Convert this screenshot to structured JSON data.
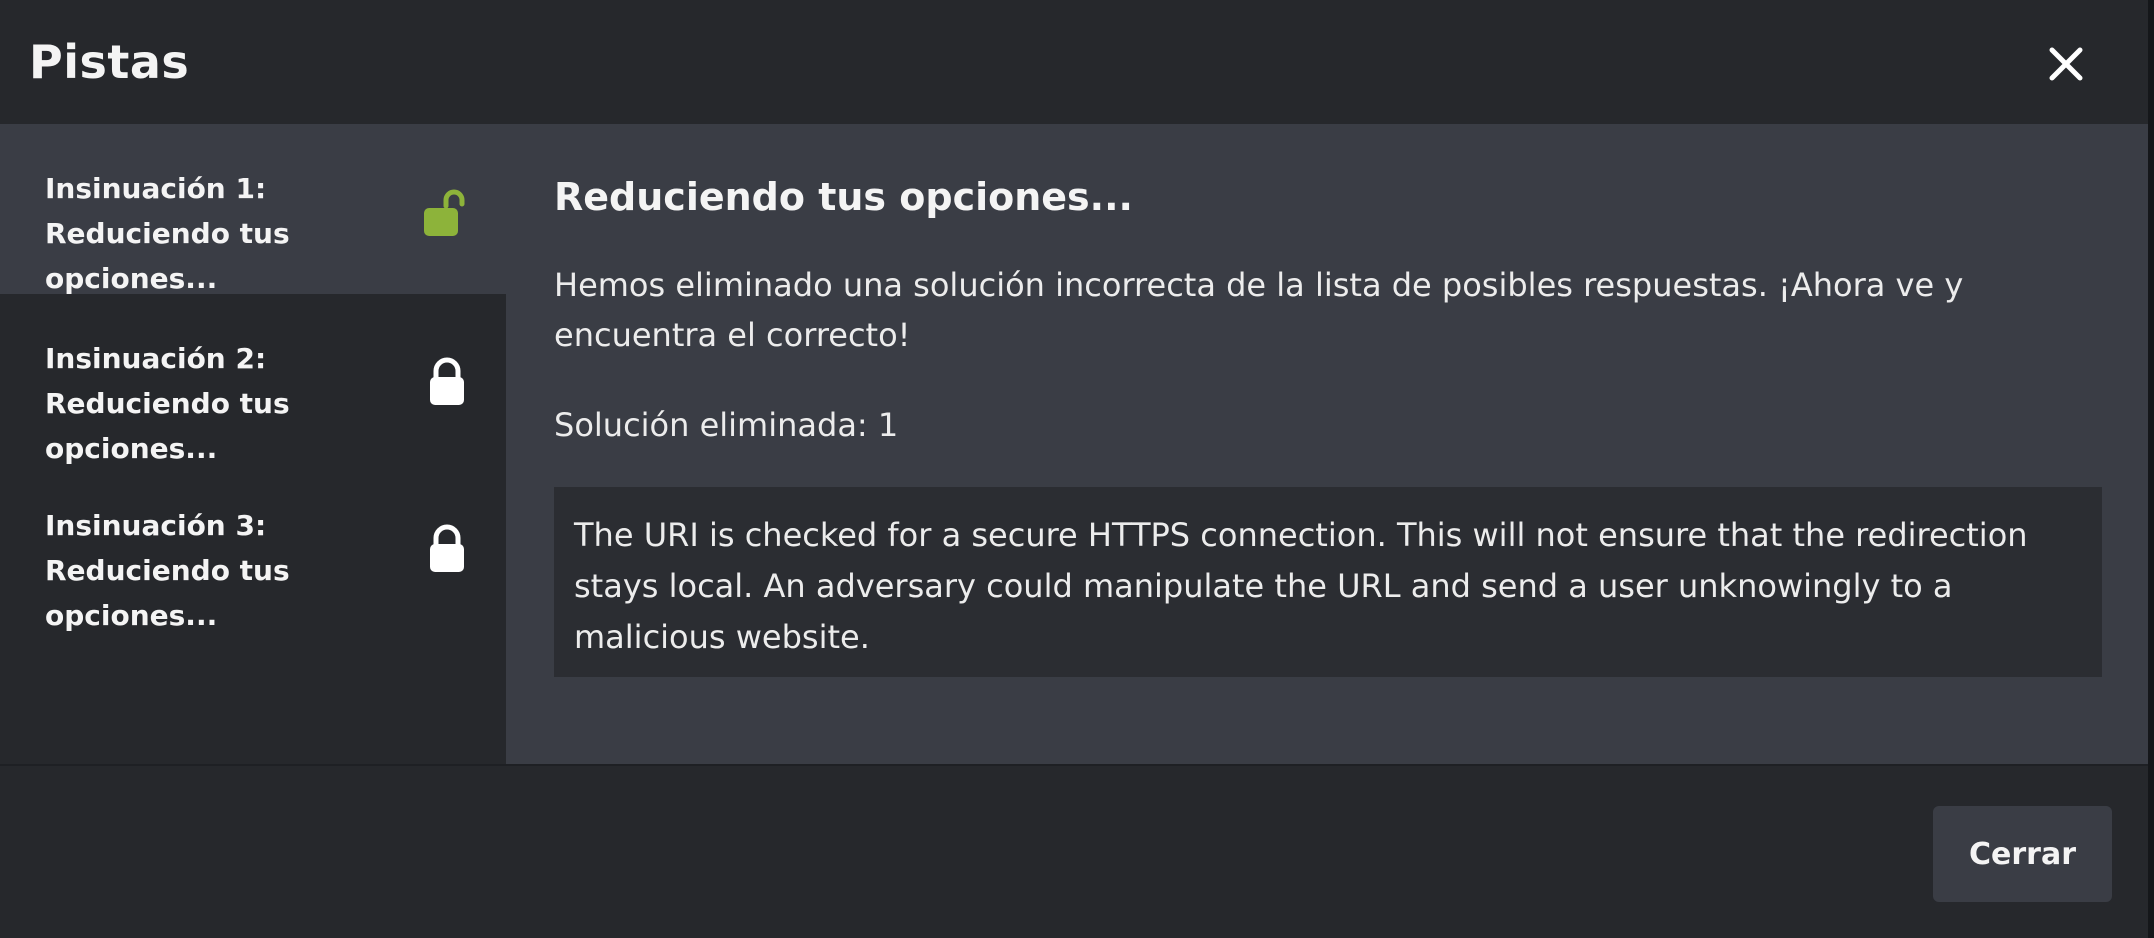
{
  "modal": {
    "title": "Pistas",
    "close_icon": "close-icon"
  },
  "sidebar": {
    "items": [
      {
        "label": "Insinuación 1: Reduciendo tus opciones...",
        "icon": "unlock-icon",
        "unlocked": true
      },
      {
        "label": "Insinuación 2: Reduciendo tus opciones...",
        "icon": "lock-icon",
        "unlocked": false
      },
      {
        "label": "Insinuación 3: Reduciendo tus opciones...",
        "icon": "lock-icon",
        "unlocked": false
      }
    ]
  },
  "hint": {
    "title": "Reduciendo tus opciones...",
    "text": "Hemos eliminado una solución incorrecta de la lista de posibles respuestas. ¡Ahora ve y encuentra el correcto!",
    "removed_label": "Solución eliminada: 1",
    "removed_answer": "The URI is checked for a secure HTTPS connection. This will not ensure that the redirection stays local. An adversary could manipulate the URL and send a user unknowingly to a malicious website."
  },
  "footer": {
    "close_label": "Cerrar"
  },
  "colors": {
    "unlocked_accent": "#8db33a",
    "locked": "#ffffff",
    "panel": "#3a3d45",
    "background": "#26282c"
  }
}
